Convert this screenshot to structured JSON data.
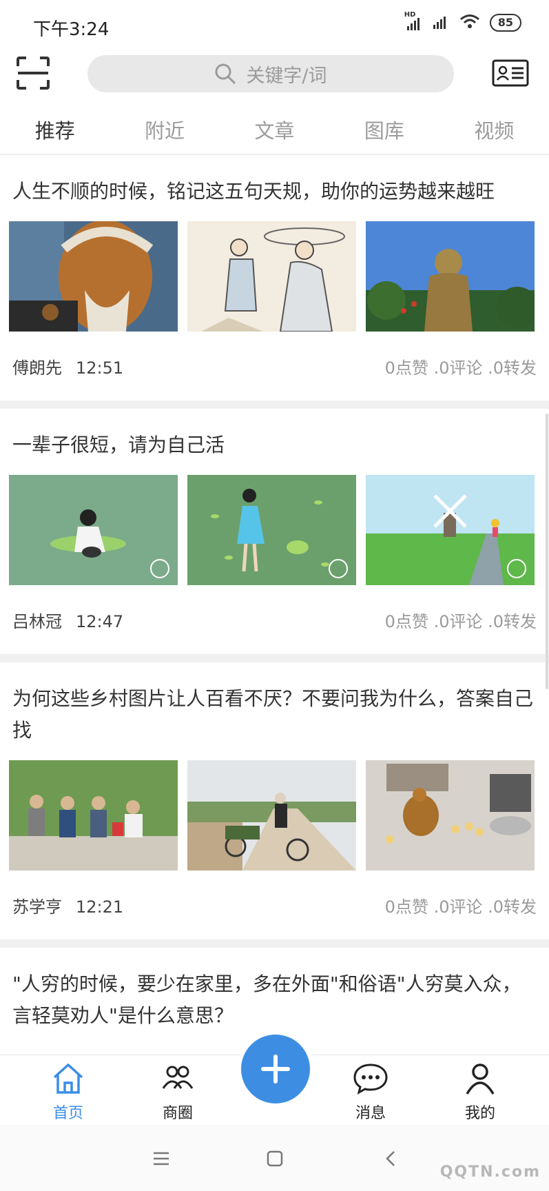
{
  "status": {
    "time": "下午3:24",
    "hd_label": "HD",
    "battery": "85"
  },
  "search": {
    "placeholder": "关键字/词"
  },
  "tabs": [
    {
      "label": "推荐",
      "active": true
    },
    {
      "label": "附近"
    },
    {
      "label": "文章"
    },
    {
      "label": "图库"
    },
    {
      "label": "视频"
    }
  ],
  "posts": [
    {
      "title": "人生不顺的时候，铭记这五句天规，助你的运势越来越旺",
      "author": "傅朗先",
      "time": "12:51",
      "stats": "0点赞 .0评论 .0转发",
      "images": [
        "old-man-painting",
        "ink-sketch-figures",
        "golden-statue"
      ]
    },
    {
      "title": "一辈子很短，请为自己活",
      "author": "吕林冠",
      "time": "12:47",
      "stats": "0点赞 .0评论 .0转发",
      "images": [
        "girl-with-cat-illustration",
        "girl-dancing-illustration",
        "windmill-field-illustration"
      ]
    },
    {
      "title": "为何这些乡村图片让人百看不厌？不要问我为什么，答案自己找",
      "author": "苏学亨",
      "time": "12:21",
      "stats": "0点赞 .0评论 .0转发",
      "images": [
        "villagers-sitting-photo",
        "bicycle-road-photo",
        "hen-with-chicks-photo"
      ]
    },
    {
      "title": "\"人穷的时候，要少在家里，多在外面\"和俗语\"人穷莫入众，言轻莫劝人\"是什么意思？"
    }
  ],
  "bottom_nav": [
    {
      "label": "首页",
      "icon": "home-icon",
      "active": true
    },
    {
      "label": "商圈",
      "icon": "people-icon"
    },
    {
      "label": "消息",
      "icon": "chat-icon"
    },
    {
      "label": "我的",
      "icon": "person-icon"
    }
  ],
  "colors": {
    "accent": "#3d8ee3",
    "inactive_tab": "#9b9b9b"
  },
  "watermark": "QQTN.com"
}
